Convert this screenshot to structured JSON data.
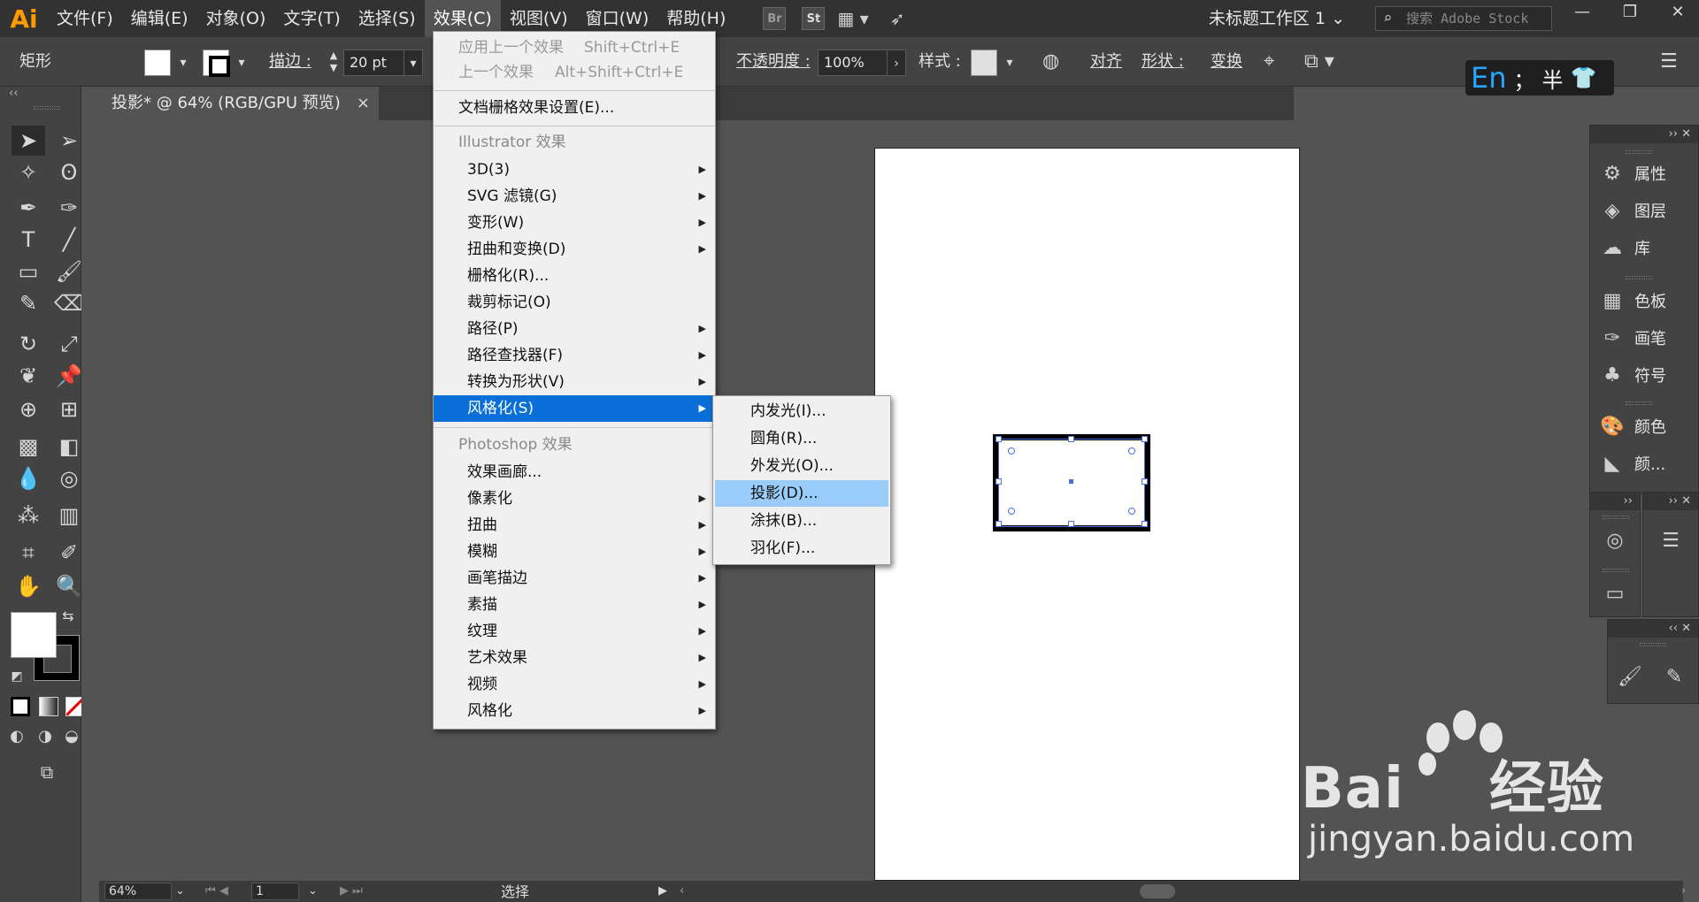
{
  "app": {
    "logo": "Ai"
  },
  "menubar": {
    "items": [
      "文件(F)",
      "编辑(E)",
      "对象(O)",
      "文字(T)",
      "选择(S)",
      "效果(C)",
      "视图(V)",
      "窗口(W)",
      "帮助(H)"
    ],
    "bridge": "Br",
    "stock": "St",
    "workspace": "未标题工作区 1",
    "search_placeholder": "搜索 Adobe Stock"
  },
  "control_bar": {
    "object_type": "矩形",
    "stroke_label": "描边 :",
    "stroke_value": "20 pt",
    "opacity_label": "不透明度 :",
    "opacity_value": "100%",
    "style_label": "样式 :",
    "align_label": "对齐",
    "shape_label": "形状 :",
    "transform_label": "变换"
  },
  "document_tab": {
    "title": "投影* @ 64% (RGB/GPU 预览)",
    "close": "×"
  },
  "effect_menu": {
    "apply_last": "应用上一个效果",
    "apply_last_shortcut": "Shift+Ctrl+E",
    "last_effect": "上一个效果",
    "last_effect_shortcut": "Alt+Shift+Ctrl+E",
    "raster_settings": "文档栅格效果设置(E)...",
    "illustrator_header": "Illustrator 效果",
    "illustrator_items": [
      "3D(3)",
      "SVG 滤镜(G)",
      "变形(W)",
      "扭曲和变换(D)",
      "栅格化(R)...",
      "裁剪标记(O)",
      "路径(P)",
      "路径查找器(F)",
      "转换为形状(V)",
      "风格化(S)"
    ],
    "photoshop_header": "Photoshop 效果",
    "photoshop_items": [
      "效果画廊...",
      "像素化",
      "扭曲",
      "模糊",
      "画笔描边",
      "素描",
      "纹理",
      "艺术效果",
      "视频",
      "风格化"
    ]
  },
  "stylize_submenu": {
    "items": [
      "内发光(I)...",
      "圆角(R)...",
      "外发光(O)...",
      "投影(D)...",
      "涂抹(B)...",
      "羽化(F)..."
    ],
    "highlighted": "投影(D)..."
  },
  "right_panels": {
    "group1": [
      "属性",
      "图层",
      "库"
    ],
    "group2": [
      "色板",
      "画笔",
      "符号"
    ],
    "group3": [
      "颜色",
      "颜..."
    ]
  },
  "status_bar": {
    "zoom": "64%",
    "artboard": "1",
    "mode": "选择"
  },
  "ime": {
    "lang": "En",
    "punct": "；",
    "width": "半"
  },
  "watermark": {
    "brand": "Bai",
    "brand2": "经验",
    "url": "jingyan.baidu.com"
  }
}
